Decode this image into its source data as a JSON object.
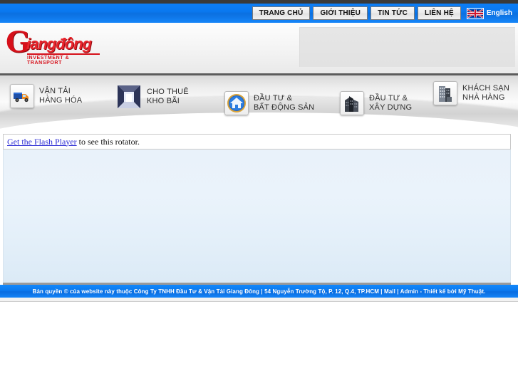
{
  "topnav": {
    "items": [
      {
        "label": "TRANG CHỦ",
        "name": "nav-trang-chu"
      },
      {
        "label": "GIỚI THIỆU",
        "name": "nav-gioi-thieu"
      },
      {
        "label": "TIN TỨC",
        "name": "nav-tin-tuc"
      },
      {
        "label": "LIÊN HỆ",
        "name": "nav-lien-he"
      }
    ],
    "language": {
      "label": "English",
      "flag": "uk-flag-icon"
    }
  },
  "header": {
    "logo": {
      "initial": "G",
      "word": "iangđông",
      "tagline": "INVESTMENT & TRANSPORT"
    }
  },
  "categories": [
    {
      "line1": "VẬN TẢI",
      "line2": "HÀNG HÓA",
      "icon": "truck-icon",
      "name": "category-van-tai-hang-hoa"
    },
    {
      "line1": "CHO THUÊ",
      "line2": "KHO BÃI",
      "icon": "warehouse-icon",
      "name": "category-cho-thue-kho-bai"
    },
    {
      "line1": "ĐẦU TƯ &",
      "line2": "BẤT ĐỘNG SẢN",
      "icon": "house-badge-icon",
      "name": "category-dau-tu-bat-dong-san"
    },
    {
      "line1": "ĐẦU TƯ &",
      "line2": "XÂY DỰNG",
      "icon": "skyscrapers-icon",
      "name": "category-dau-tu-xay-dung"
    },
    {
      "line1": "KHÁCH SẠN",
      "line2": "NHÀ HÀNG",
      "icon": "hotel-icon",
      "name": "category-khach-san-nha-hang"
    }
  ],
  "flash_notice": {
    "link_text": "Get the Flash Player",
    "rest_text": "to see this rotator."
  },
  "footer": {
    "text": "Bản quyền © của website này thuộc Công Ty TNHH Đầu Tư & Vận Tải Giang Đông | 54 Nguyễn Trường Tộ, P. 12, Q.4, TP.HCM | Mail | Admin - Thiết kế bởi Mỹ Thuật."
  },
  "colors": {
    "brand_red": "#d6101a",
    "nav_blue": "#0b79ef",
    "link_blue": "#2b2bd4",
    "rule_gray": "#5c5c5c"
  }
}
